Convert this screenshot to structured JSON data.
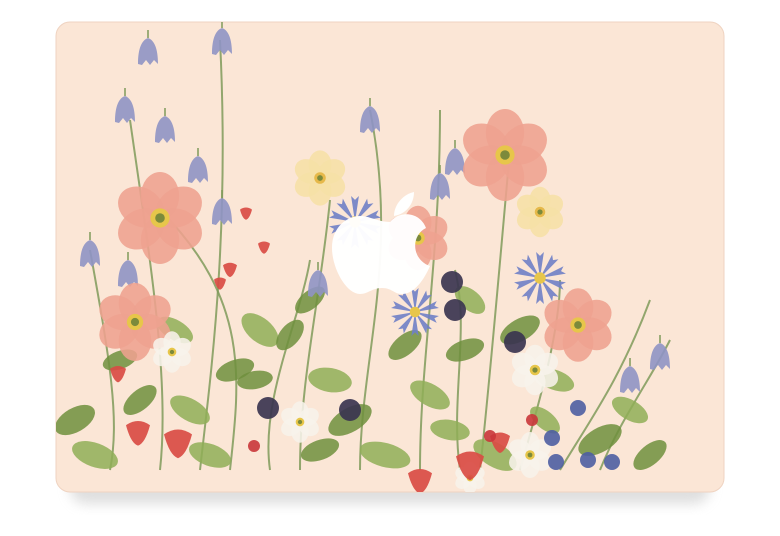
{
  "scene": {
    "subject": "laptop-skin-wildflowers",
    "colors": {
      "panel": "#fbe6d6",
      "panel_edge": "#efd3c1",
      "shadow": "#d9d9d9",
      "stem": "#7f9a5a",
      "leaf": "#8fae57",
      "leaf_dark": "#6e8f3d",
      "poppy": "#eea28f",
      "poppy_center": "#e7c64a",
      "bluebell": "#8f93c4",
      "cornflower": "#6f80c6",
      "cream_flower": "#f6e0a6",
      "white_flower": "#f7f2ea",
      "strawberry": "#d94c44",
      "blackberry": "#3b3550",
      "blueberry": "#4e5ea2",
      "red_berry": "#c9363a",
      "apple_logo": "#ffffff"
    },
    "icons": [
      "apple-logo-icon"
    ]
  }
}
